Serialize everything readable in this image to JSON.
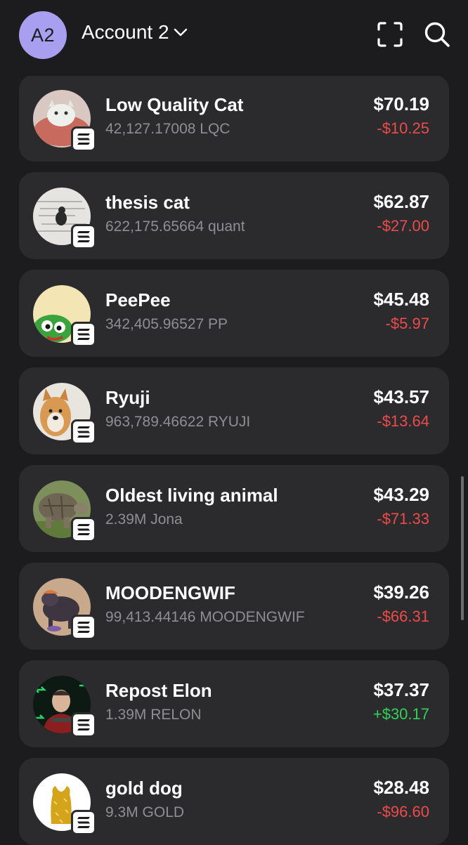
{
  "header": {
    "avatar_initials": "A2",
    "account_name": "Account 2",
    "scan_icon": "scan-icon",
    "search_icon": "search-icon"
  },
  "colors": {
    "background": "#1c1c1e",
    "card": "#2b2b2e",
    "avatar": "#a99ff0",
    "negative": "#eb4b4b",
    "positive": "#31d158",
    "secondary_text": "#8e8e93"
  },
  "tokens": [
    {
      "name": "Low Quality Cat",
      "amount": "42,127.17008 LQC",
      "usd": "$70.19",
      "change": "-$10.25",
      "direction": "negative"
    },
    {
      "name": "thesis cat",
      "amount": "622,175.65664 quant",
      "usd": "$62.87",
      "change": "-$27.00",
      "direction": "negative"
    },
    {
      "name": "PeePee",
      "amount": "342,405.96527 PP",
      "usd": "$45.48",
      "change": "-$5.97",
      "direction": "negative"
    },
    {
      "name": "Ryuji",
      "amount": "963,789.46622 RYUJI",
      "usd": "$43.57",
      "change": "-$13.64",
      "direction": "negative"
    },
    {
      "name": "Oldest living animal",
      "amount": "2.39M Jona",
      "usd": "$43.29",
      "change": "-$71.33",
      "direction": "negative"
    },
    {
      "name": "MOODENGWIF",
      "amount": "99,413.44146 MOODENGWIF",
      "usd": "$39.26",
      "change": "-$66.31",
      "direction": "negative"
    },
    {
      "name": "Repost Elon",
      "amount": "1.39M RELON",
      "usd": "$37.37",
      "change": "+$30.17",
      "direction": "positive"
    },
    {
      "name": "gold dog",
      "amount": "9.3M GOLD",
      "usd": "$28.48",
      "change": "-$96.60",
      "direction": "negative"
    }
  ]
}
